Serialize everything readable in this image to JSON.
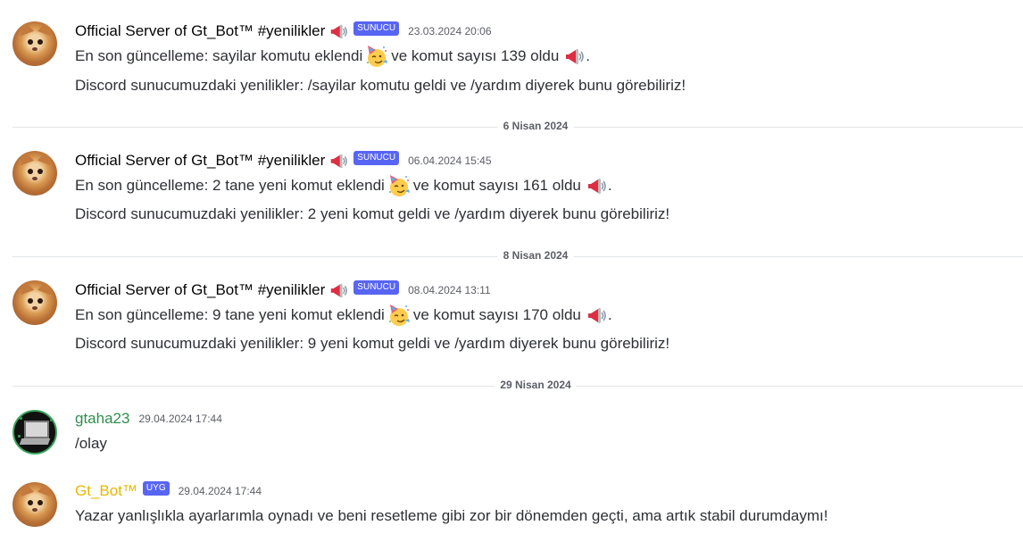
{
  "messages": [
    {
      "author": "Official Server of Gt_Bot™ #yenilikler",
      "tag": "SUNUCU",
      "time": "23.03.2024 20:06",
      "line1a": "En son güncelleme: sayilar komutu eklendi",
      "line1b": "ve komut sayısı 139 oldu",
      "line2": "Discord sunucumuzdaki yenilikler: /sayilar komutu geldi ve /yardım diyerek bunu görebiliriz!"
    },
    {
      "author": "Official Server of Gt_Bot™ #yenilikler",
      "tag": "SUNUCU",
      "time": "06.04.2024 15:45",
      "line1a": "En son güncelleme: 2 tane yeni komut eklendi",
      "line1b": "ve komut sayısı 161 oldu",
      "line2": "Discord sunucumuzdaki yenilikler: 2 yeni komut geldi ve /yardım diyerek bunu görebiliriz!"
    },
    {
      "author": "Official Server of Gt_Bot™ #yenilikler",
      "tag": "SUNUCU",
      "time": "08.04.2024 13:11",
      "line1a": "En son güncelleme: 9 tane yeni komut eklendi",
      "line1b": "ve komut sayısı 170 oldu",
      "line2": "Discord sunucumuzdaki yenilikler: 9 yeni komut geldi ve /yardım diyerek bunu görebiliriz!"
    },
    {
      "author": "gtaha23",
      "time": "29.04.2024 17:44",
      "line1": "/olay"
    },
    {
      "author": "Gt_Bot™",
      "tag": "UYG",
      "time": "29.04.2024 17:44",
      "line1": "Yazar yanlışlıkla ayarlarımla oynadı ve beni resetleme gibi zor bir dönemden geçti, ama artık stabil durumdaymı!"
    }
  ],
  "dividers": [
    "6 Nisan 2024",
    "8 Nisan 2024",
    "29 Nisan 2024"
  ],
  "icons": {
    "megaphone": "megaphone-icon",
    "party_face": "partying-face-icon"
  },
  "colors": {
    "tag_bg": "#5865f2",
    "user_green": "#2f8f4e",
    "bot_gold": "#e6b800"
  }
}
